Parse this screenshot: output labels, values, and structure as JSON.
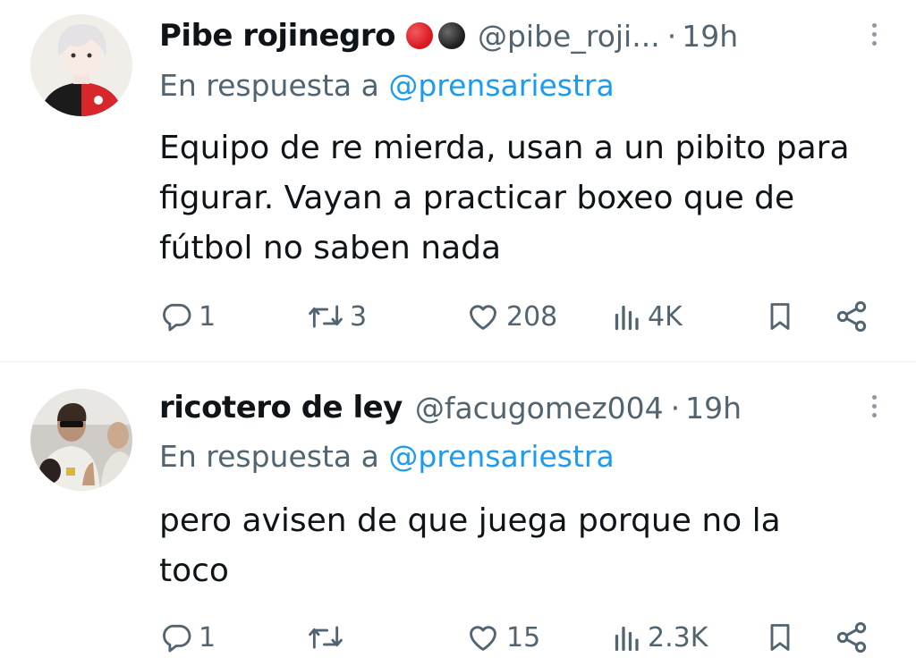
{
  "tweets": [
    {
      "author_name": "Pibe rojinegro",
      "badges": [
        "#e0242a",
        "#222222"
      ],
      "handle": "@pibe_roji...",
      "separator": "·",
      "time": "19h",
      "reply_prefix": "En respuesta a",
      "reply_mention": "@prensariestra",
      "text": "Equipo de re mierda, usan a un pibito para figurar. Vayan a practicar boxeo que de fútbol no saben nada",
      "replies": "1",
      "retweets": "3",
      "likes": "208",
      "views": "4K"
    },
    {
      "author_name": "ricotero de ley",
      "handle": "@facugomez004",
      "separator": "·",
      "time": "19h",
      "reply_prefix": "En respuesta a",
      "reply_mention": "@prensariestra",
      "text": "pero avisen de que juega porque no la toco",
      "replies": "1",
      "retweets": "",
      "likes": "15",
      "views": "2.3K"
    }
  ],
  "colors": {
    "secondary_text": "#536471",
    "link": "#1d9bf0",
    "divider": "#eff3f4"
  },
  "icons": [
    "reply-icon",
    "retweet-icon",
    "like-icon",
    "views-icon",
    "bookmark-icon",
    "share-icon",
    "more-icon"
  ]
}
